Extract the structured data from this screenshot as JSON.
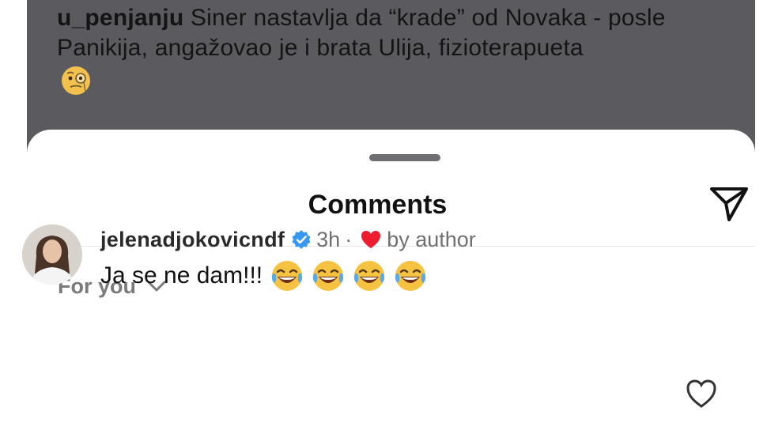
{
  "post": {
    "username": "u_penjanju",
    "caption": "Siner nastavlja da “krade” od Novaka - posle Panikija, angažovao je i brata Ulija, fizioterapueta",
    "caption_emoji": "face-with-monocle-emoji"
  },
  "sheet": {
    "title": "Comments",
    "share_icon": "paper-plane-icon",
    "sort_label": "For you",
    "sort_icon": "chevron-down-icon"
  },
  "comments": [
    {
      "handle": "jelenadjokovicndf",
      "verified": true,
      "time": "3h",
      "separator": "·",
      "liked_by_author_label": "by author",
      "text": "Ja se ne dam!!!",
      "emojis": [
        "tears-of-joy-emoji",
        "tears-of-joy-emoji",
        "tears-of-joy-emoji",
        "tears-of-joy-emoji"
      ]
    }
  ],
  "colors": {
    "backdrop": "#5b5b5f",
    "verified": "#3897f0",
    "heart": "#ed1c2e",
    "muted_text": "#6f6f6f"
  }
}
